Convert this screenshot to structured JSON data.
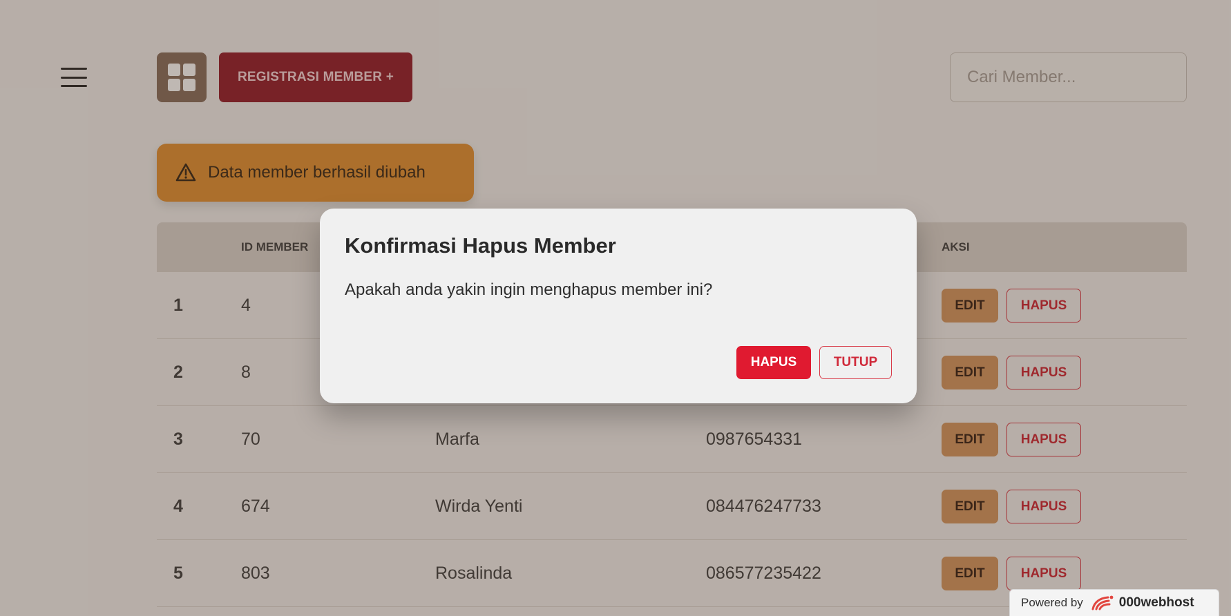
{
  "header": {
    "menu_icon": "hamburger-icon",
    "dashboard_icon": "grid-icon",
    "register_label": "REGISTRASI MEMBER +",
    "search_placeholder": "Cari Member..."
  },
  "alert": {
    "icon": "warning-icon",
    "message": "Data member berhasil diubah",
    "color": "#e39337"
  },
  "table": {
    "headers": {
      "number": "",
      "id": "ID MEMBER",
      "name": "",
      "phone": "",
      "action": "AKSI"
    },
    "rows": [
      {
        "no": "1",
        "id": "4",
        "name": "",
        "phone": ""
      },
      {
        "no": "2",
        "id": "8",
        "name": "",
        "phone": ""
      },
      {
        "no": "3",
        "id": "70",
        "name": "Marfa",
        "phone": "0987654331"
      },
      {
        "no": "4",
        "id": "674",
        "name": "Wirda Yenti",
        "phone": "084476247733"
      },
      {
        "no": "5",
        "id": "803",
        "name": "Rosalinda",
        "phone": "086577235422"
      }
    ],
    "edit_label": "EDIT",
    "delete_label": "HAPUS"
  },
  "modal": {
    "title": "Konfirmasi Hapus Member",
    "message": "Apakah anda yakin ingin menghapus member ini?",
    "confirm_label": "HAPUS",
    "close_label": "TUTUP"
  },
  "footer": {
    "powered_by": "Powered by",
    "brand": "000webhost",
    "brand_icon": "000webhost-logo-icon"
  },
  "colors": {
    "primary": "#95202f",
    "danger": "#e01a30",
    "edit": "#d69863",
    "warning": "#e39337"
  }
}
